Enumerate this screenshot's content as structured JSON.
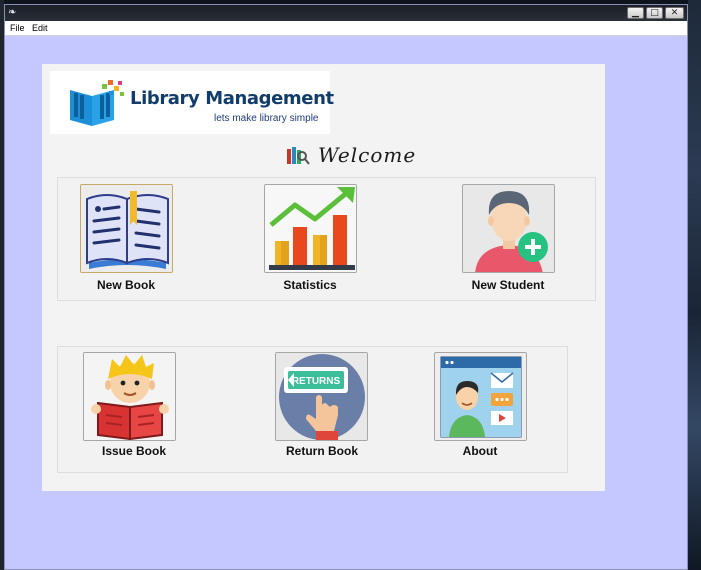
{
  "window": {
    "title": ""
  },
  "menubar": {
    "items": [
      "File",
      "Edit"
    ]
  },
  "window_controls": {
    "minimize": "▁",
    "maximize": "□",
    "close": "✕"
  },
  "logo": {
    "title": "Library Management",
    "tagline": "lets make library simple"
  },
  "welcome": {
    "text": "Welcome"
  },
  "tiles": {
    "new_book": {
      "label": "New Book",
      "icon": "open-book-icon"
    },
    "statistics": {
      "label": "Statistics",
      "icon": "bar-chart-icon"
    },
    "new_student": {
      "label": "New Student",
      "icon": "add-user-icon"
    },
    "issue_book": {
      "label": "Issue Book",
      "icon": "reading-boy-icon"
    },
    "return_book": {
      "label": "Return Book",
      "icon": "returns-hand-icon"
    },
    "about": {
      "label": "About",
      "icon": "profile-card-icon"
    }
  },
  "colors": {
    "window_bg": "#c5c8ff",
    "panel_bg": "#f3f3f3",
    "logo_blue": "#123c6a"
  }
}
